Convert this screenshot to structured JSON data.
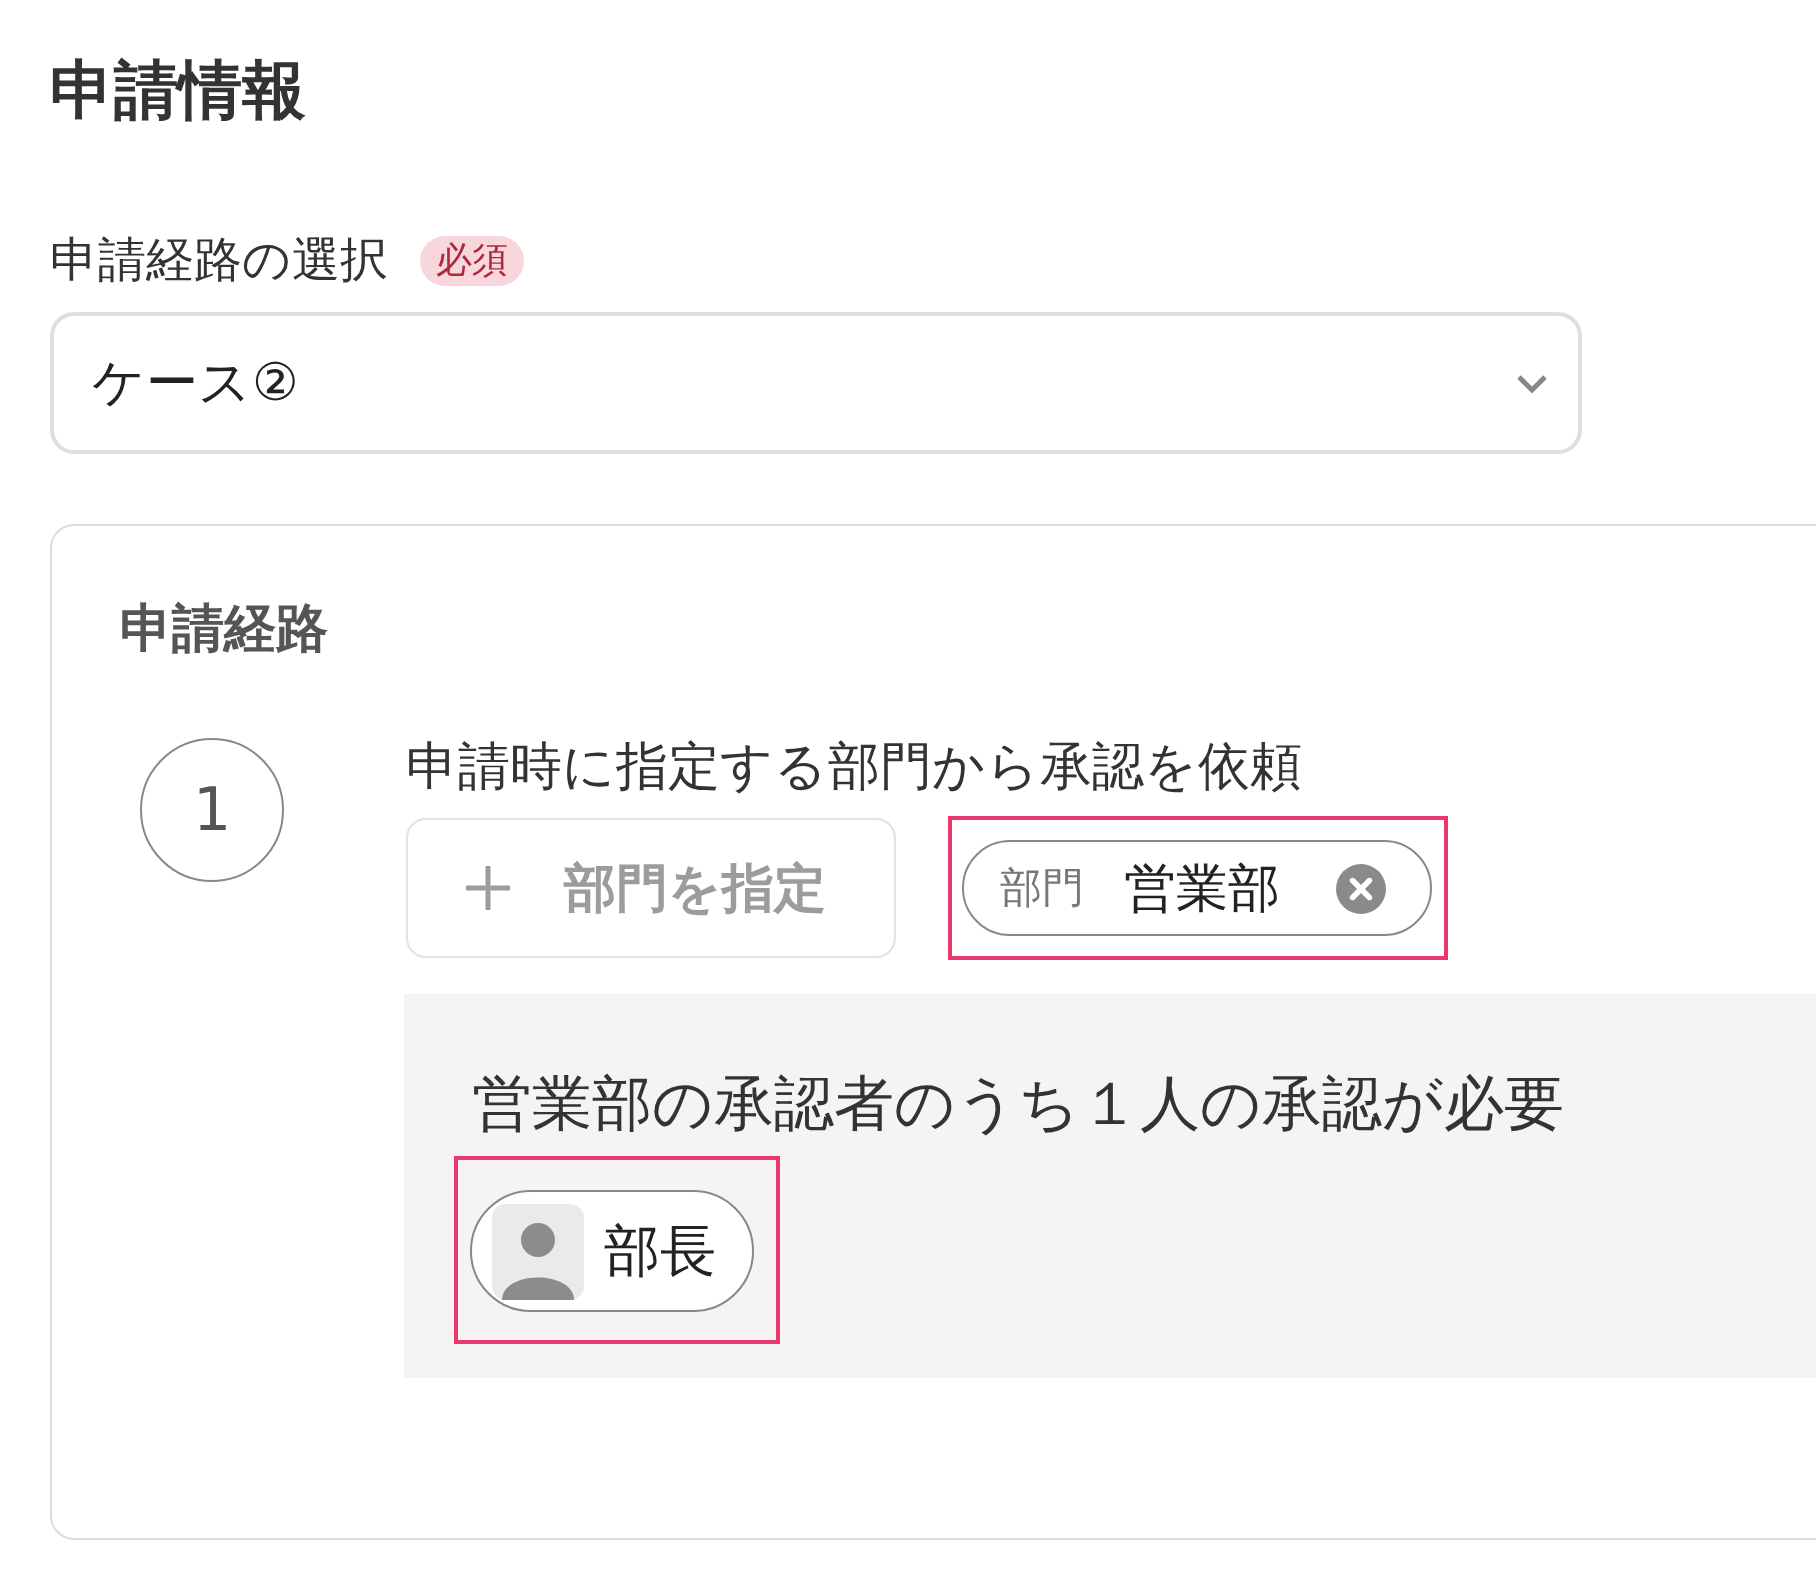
{
  "page": {
    "title": "申請情報"
  },
  "route_select": {
    "label": "申請経路の選択",
    "required_badge": "必須",
    "value": "ケース②"
  },
  "route": {
    "title": "申請経路",
    "steps": [
      {
        "number": "1",
        "description": "申請時に指定する部門から承認を依頼",
        "add_button": {
          "label": "部門を指定",
          "disabled": true
        },
        "departments": [
          {
            "prefix": "部門",
            "name": "営業部",
            "highlighted": true
          }
        ],
        "approval": {
          "requirement": "営業部の承認者のうち１人の承認が必要",
          "approvers": [
            {
              "name": "部長",
              "highlighted": true
            }
          ]
        }
      }
    ]
  }
}
